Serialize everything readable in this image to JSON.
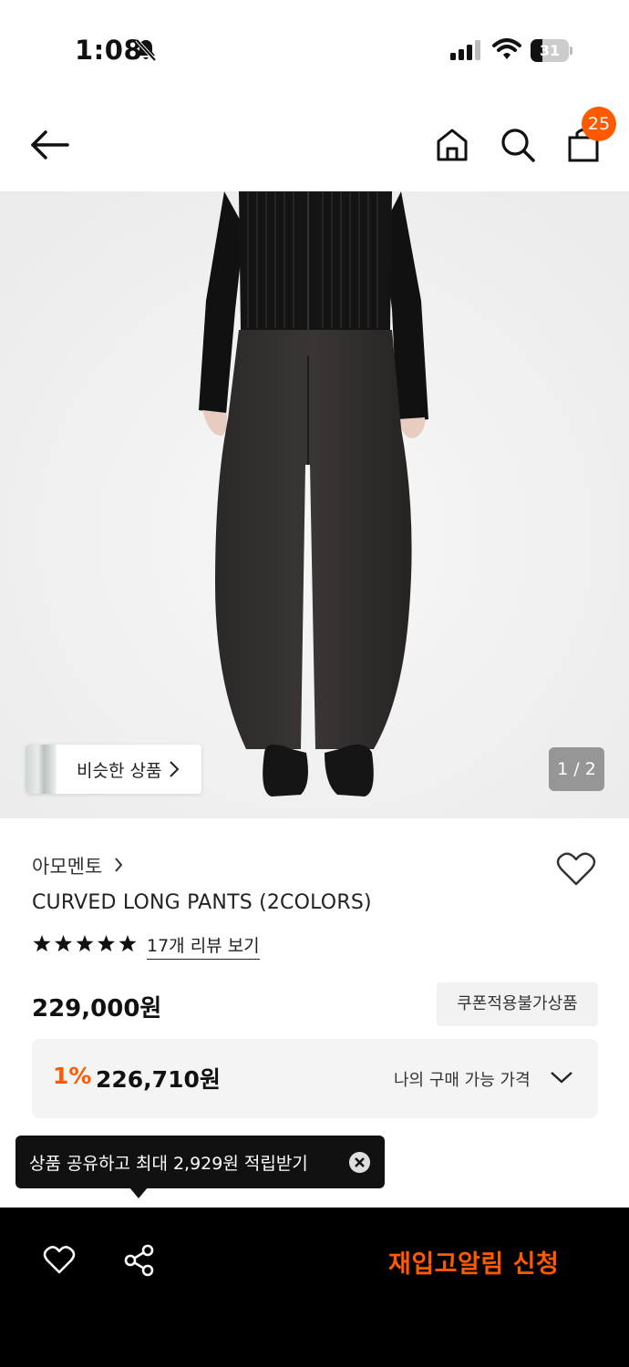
{
  "status_bar": {
    "time": "1:08",
    "battery": "31",
    "battery_level": 0.31
  },
  "header": {
    "cart_count": "25"
  },
  "gallery": {
    "similar_label": "비슷한 상품",
    "page_indicator": "1 / 2"
  },
  "product": {
    "brand": "아모멘토",
    "name": "CURVED LONG PANTS (2COLORS)",
    "rating": 5,
    "review_link": "17개 리뷰 보기",
    "price": "229,000원",
    "coupon_badge": "쿠폰적용불가상품",
    "discount_rate": "1%",
    "discount_price": "226,710원",
    "my_price_label": "나의 구매 가능 가격"
  },
  "tooltip": {
    "text": "상품 공유하고 최대 2,929원 적립받기"
  },
  "bottom_bar": {
    "restock_label": "재입고알림 신청"
  },
  "colors": {
    "accent": "#ff5a00",
    "background": "#ffffff",
    "bottom_bar": "#000000",
    "hero_background": "#f3f3f3"
  },
  "icons": [
    "bell-off-icon",
    "signal-icon",
    "wifi-icon",
    "battery-icon",
    "back-arrow-icon",
    "home-icon",
    "search-icon",
    "shopping-bag-icon",
    "chevron-right-icon",
    "heart-outline-icon",
    "star-icon",
    "chevron-down-icon",
    "close-icon",
    "share-icon"
  ]
}
